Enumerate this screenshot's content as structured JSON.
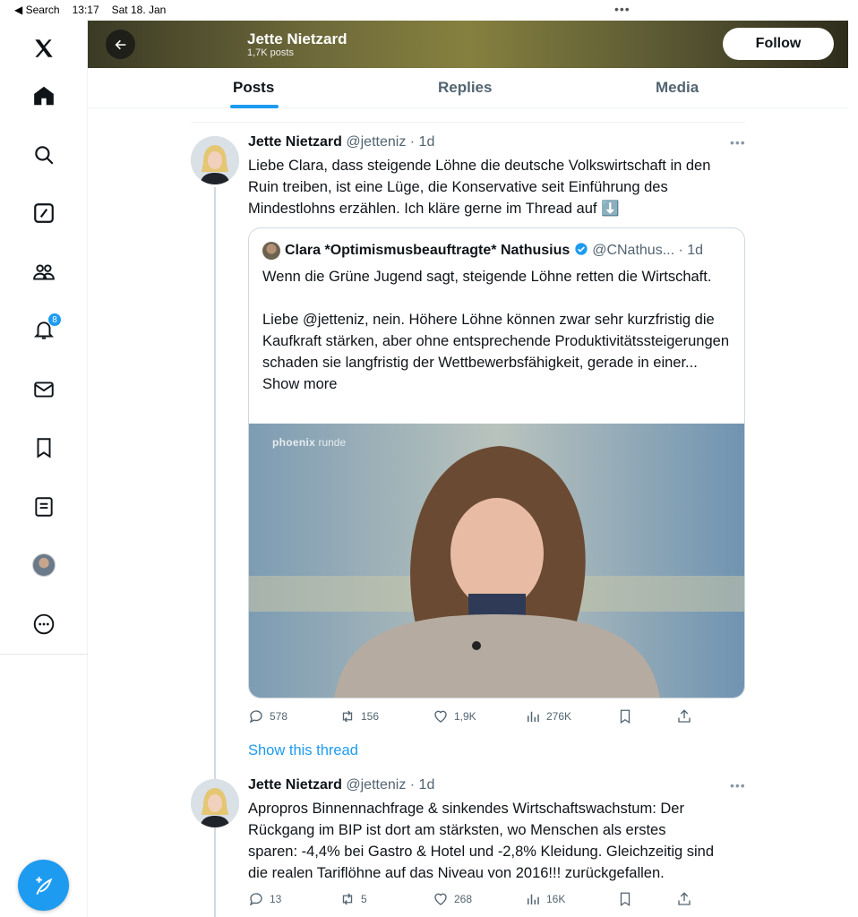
{
  "status_bar": {
    "back_label": "◀ Search",
    "time": "13:17",
    "date": "Sat 18. Jan",
    "dots": "•••"
  },
  "nav": {
    "items": [
      {
        "name": "x-logo-icon"
      },
      {
        "name": "home-icon"
      },
      {
        "name": "search-icon"
      },
      {
        "name": "grok-icon"
      },
      {
        "name": "communities-icon"
      },
      {
        "name": "notifications-icon",
        "badge": "8"
      },
      {
        "name": "messages-icon"
      },
      {
        "name": "bookmarks-icon"
      },
      {
        "name": "lists-icon"
      },
      {
        "name": "profile-avatar"
      },
      {
        "name": "more-icon"
      }
    ],
    "compose_label": "+"
  },
  "profile_header": {
    "name": "Jette Nietzard",
    "posts_count": "1,7K posts",
    "follow_label": "Follow"
  },
  "tabs": [
    {
      "label": "Posts",
      "active": true
    },
    {
      "label": "Replies",
      "active": false
    },
    {
      "label": "Media",
      "active": false
    }
  ],
  "tweets": [
    {
      "name": "Jette Nietzard",
      "handle": "@jetteniz",
      "time": "· 1d",
      "text_lines": [
        "Liebe Clara, dass steigende Löhne die deutsche Volkswirtschaft in den",
        "Ruin treiben, ist eine Lüge, die Konservative seit Einführung des",
        "Mindestlohns erzählen. Ich kläre gerne im Thread auf ⬇️"
      ],
      "quote": {
        "name": "Clara *Optimismusbeauftragte* Nathusius",
        "handle": "@CNathus...",
        "time": "· 1d",
        "para1": "Wenn die Grüne Jugend sagt, steigende Löhne retten die Wirtschaft.",
        "para2": "Liebe @jetteniz, nein. Höhere Löhne können zwar sehr kurzfristig die Kaufkraft stärken, aber ohne entsprechende Produktivitätssteigerungen schaden sie langfristig der Wettbewerbsfähigkeit, gerade in einer...",
        "show_more": "Show more",
        "image_logo_bold": "phoenix",
        "image_logo_rest": " runde"
      },
      "stats": {
        "replies": "578",
        "reposts": "156",
        "likes": "1,9K",
        "views": "276K"
      }
    },
    {
      "name": "Jette Nietzard",
      "handle": "@jetteniz",
      "time": "· 1d",
      "text_lines": [
        "Apropros Binnennachfrage & sinkendes Wirtschaftswachstum: Der",
        "Rückgang im BIP ist dort am stärksten, wo Menschen als erstes",
        "sparen: -4,4% bei Gastro & Hotel und -2,8% Kleidung. Gleichzeitig sind",
        "die realen Tariflöhne auf das Niveau von 2016!!! zurückgefallen."
      ],
      "stats": {
        "replies": "13",
        "reposts": "5",
        "likes": "268",
        "views": "16K"
      }
    }
  ],
  "show_thread_label": "Show this thread",
  "colors": {
    "accent": "#1d9bf0",
    "text": "#0f1419",
    "muted": "#536471"
  }
}
